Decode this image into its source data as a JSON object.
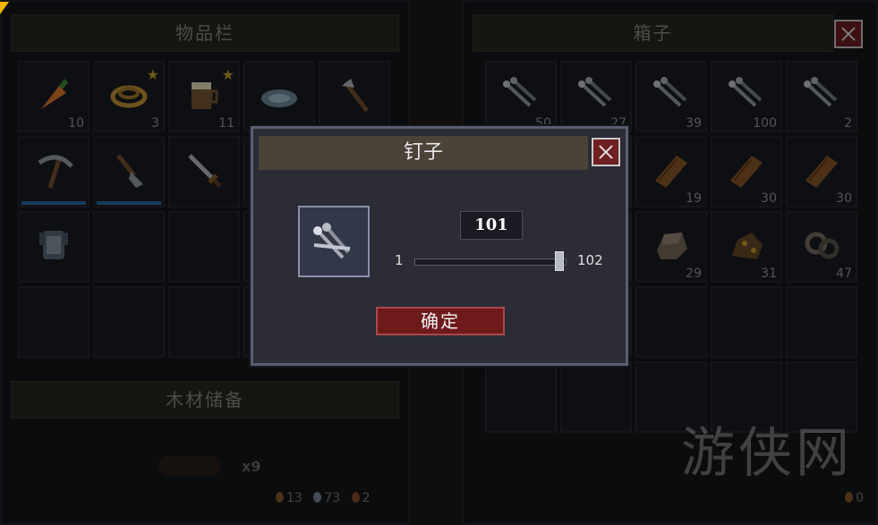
{
  "inventory": {
    "title": "物品栏",
    "slots": [
      {
        "icon": "carrot-icon",
        "count": "10",
        "star": false,
        "durability": false
      },
      {
        "icon": "rope-icon",
        "count": "3",
        "star": true,
        "durability": false
      },
      {
        "icon": "mug-icon",
        "count": "11",
        "star": true,
        "durability": false
      },
      {
        "icon": "plate-icon",
        "count": "",
        "star": false,
        "durability": false
      },
      {
        "icon": "axe-icon",
        "count": "",
        "star": false,
        "durability": false
      },
      {
        "icon": "pickaxe-icon",
        "count": "",
        "star": false,
        "durability": true
      },
      {
        "icon": "shovel-icon",
        "count": "",
        "star": false,
        "durability": true
      },
      {
        "icon": "sword-icon",
        "count": "",
        "star": false,
        "durability": false
      },
      {
        "icon": "empty",
        "count": "",
        "star": false,
        "durability": false
      },
      {
        "icon": "empty",
        "count": "",
        "star": false,
        "durability": false
      },
      {
        "icon": "armor-icon",
        "count": "",
        "star": false,
        "durability": false
      }
    ],
    "wood_storage_title": "木材储备",
    "wood_count": "x9",
    "resources": [
      "13",
      "73",
      "2"
    ]
  },
  "chest": {
    "title": "箱子",
    "slots": [
      {
        "icon": "nails-icon",
        "count": "50"
      },
      {
        "icon": "nails-icon",
        "count": "27"
      },
      {
        "icon": "nails-icon",
        "count": "39"
      },
      {
        "icon": "nails-icon",
        "count": "100"
      },
      {
        "icon": "nails-icon",
        "count": "2"
      },
      {
        "icon": "empty",
        "count": ""
      },
      {
        "icon": "empty",
        "count": ""
      },
      {
        "icon": "plank-icon",
        "count": "19"
      },
      {
        "icon": "plank-icon",
        "count": "30"
      },
      {
        "icon": "plank-icon",
        "count": "30"
      },
      {
        "icon": "empty",
        "count": ""
      },
      {
        "icon": "empty",
        "count": ""
      },
      {
        "icon": "stone-icon",
        "count": "29"
      },
      {
        "icon": "ore-icon",
        "count": "31"
      },
      {
        "icon": "scrap-icon",
        "count": "47"
      }
    ],
    "resources": [
      "0"
    ]
  },
  "dialog": {
    "title": "钉子",
    "quantity": "101",
    "min": "1",
    "max": "102",
    "slider_fraction": 0.99,
    "confirm_label": "确定"
  },
  "watermark": "游侠网",
  "colors": {
    "accent_red": "#6f1f21",
    "durability_blue": "#2b6fa8"
  }
}
